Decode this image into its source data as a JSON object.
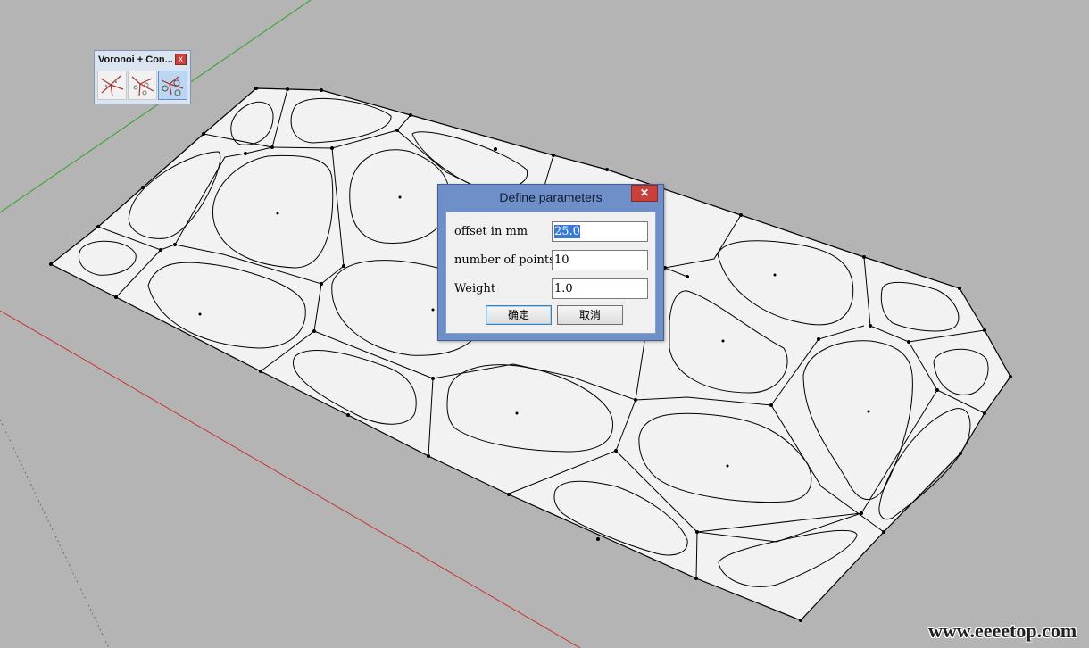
{
  "toolbar": {
    "title": "Voronoi + Con...",
    "close_label": "x",
    "buttons": [
      {
        "icon": "voronoi-lines-icon"
      },
      {
        "icon": "voronoi-points-icon"
      },
      {
        "icon": "voronoi-cells-icon",
        "active": true
      }
    ]
  },
  "dialog": {
    "title": "Define parameters",
    "close_label": "✕",
    "fields": [
      {
        "label": "offset in mm",
        "value": "25.0"
      },
      {
        "label": "number of points",
        "value": "10"
      },
      {
        "label": "Weight",
        "value": "1.0"
      }
    ],
    "ok_label": "确定",
    "cancel_label": "取消"
  },
  "watermark": "www.eeeetop.com",
  "colors": {
    "viewport_bg": "#b4b4b4",
    "green_axis": "#2fa32f",
    "red_axis": "#c83232",
    "surface_fill": "#f2f2f2",
    "dialog_frame": "#6f8fc8",
    "close_red": "#c9413a"
  }
}
